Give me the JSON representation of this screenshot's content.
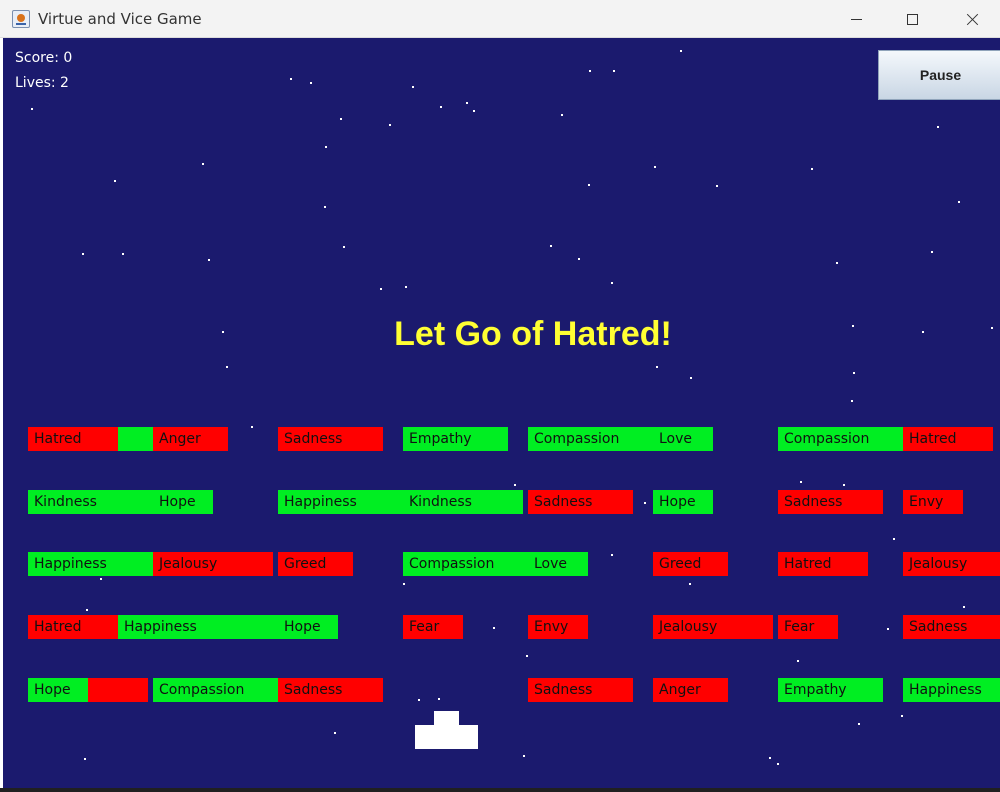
{
  "window": {
    "title": "Virtue and Vice Game"
  },
  "hud": {
    "score_text": "Score: 0",
    "lives_text": "Lives: 2"
  },
  "controls": {
    "pause_label": "Pause"
  },
  "message": "Let Go of Hatred!",
  "colors": {
    "background": "#1b1a6e",
    "virtue": "#00ee22",
    "vice": "#ff0000",
    "message": "#ffff33"
  },
  "bricks": [
    {
      "label": "Hatred",
      "type": "vice"
    },
    {
      "label": "",
      "type": "virtue"
    },
    {
      "label": "Anger",
      "type": "vice"
    },
    {
      "label": "Sadness",
      "type": "vice"
    },
    {
      "label": "Empathy",
      "type": "virtue"
    },
    {
      "label": "Compassion",
      "type": "virtue"
    },
    {
      "label": "Love",
      "type": "virtue"
    },
    {
      "label": "Compassion",
      "type": "virtue"
    },
    {
      "label": "Hatred",
      "type": "vice"
    },
    {
      "label": "Kindness",
      "type": "virtue"
    },
    {
      "label": "Hope",
      "type": "virtue"
    },
    {
      "label": "Happiness",
      "type": "virtue"
    },
    {
      "label": "Kindness",
      "type": "virtue"
    },
    {
      "label": "Sadness",
      "type": "vice"
    },
    {
      "label": "Hope",
      "type": "virtue"
    },
    {
      "label": "Sadness",
      "type": "vice"
    },
    {
      "label": "Envy",
      "type": "vice"
    },
    {
      "label": "Happiness",
      "type": "virtue"
    },
    {
      "label": "Jealousy",
      "type": "vice"
    },
    {
      "label": "Greed",
      "type": "vice"
    },
    {
      "label": "Compassion",
      "type": "virtue"
    },
    {
      "label": "Love",
      "type": "virtue"
    },
    {
      "label": "Greed",
      "type": "vice"
    },
    {
      "label": "Hatred",
      "type": "vice"
    },
    {
      "label": "Jealousy",
      "type": "vice"
    },
    {
      "label": "Hatred",
      "type": "vice"
    },
    {
      "label": "Happiness",
      "type": "virtue"
    },
    {
      "label": "Hope",
      "type": "virtue"
    },
    {
      "label": "Fear",
      "type": "vice"
    },
    {
      "label": "Envy",
      "type": "vice"
    },
    {
      "label": "Jealousy",
      "type": "vice"
    },
    {
      "label": "Fear",
      "type": "vice"
    },
    {
      "label": "Sadness",
      "type": "vice"
    },
    {
      "label": "Hope",
      "type": "virtue"
    },
    {
      "label": "",
      "type": "vice"
    },
    {
      "label": "Compassion",
      "type": "virtue"
    },
    {
      "label": "Sadness",
      "type": "vice"
    },
    {
      "label": "Sadness",
      "type": "vice"
    },
    {
      "label": "Anger",
      "type": "vice"
    },
    {
      "label": "Empathy",
      "type": "virtue"
    },
    {
      "label": "Happiness",
      "type": "virtue"
    }
  ]
}
